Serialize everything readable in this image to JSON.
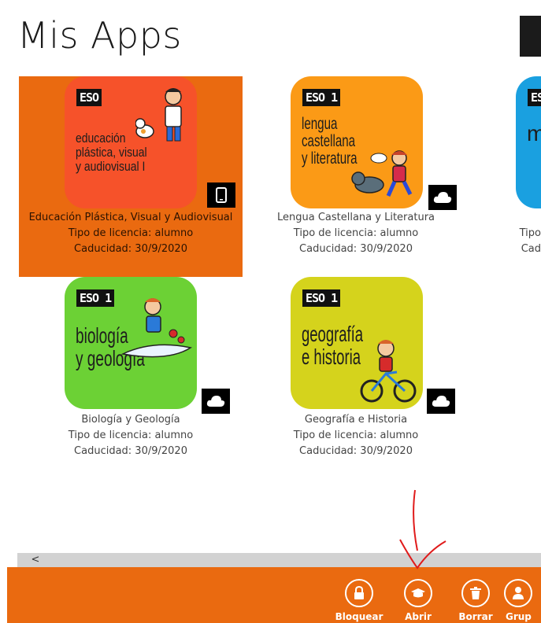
{
  "header": {
    "title": "Mis Apps"
  },
  "apps": [
    {
      "id": "plastica",
      "eso_label": "ESO",
      "cover_title": "educación\nplástica, visual\ny audiovisual I",
      "cover_color": "#f6522a",
      "badge_icon": "device-icon",
      "name": "Educación Plástica, Visual y Audiovisual",
      "license": "Tipo de licencia: alumno",
      "expiry": "Caducidad: 30/9/2020",
      "selected": true
    },
    {
      "id": "lengua",
      "eso_label": "ESO 1",
      "cover_title": "lengua castellana\ny literatura",
      "cover_color": "#fb9a16",
      "badge_icon": "cloud-icon",
      "name": "Lengua Castellana y Literatura",
      "license": "Tipo de licencia: alumno",
      "expiry": "Caducidad: 30/9/2020",
      "selected": false
    },
    {
      "id": "mates",
      "eso_label": "ES",
      "cover_title": "m",
      "cover_color": "#1aa0e0",
      "name": "",
      "license": "Tipo",
      "expiry": "Cad",
      "selected": false
    },
    {
      "id": "biologia",
      "eso_label": "ESO 1",
      "cover_title": "biología\ny geología",
      "cover_color": "#6cd135",
      "badge_icon": "cloud-icon",
      "name": "Biología y Geología",
      "license": "Tipo de licencia: alumno",
      "expiry": "Caducidad: 30/9/2020",
      "selected": false
    },
    {
      "id": "geografia",
      "eso_label": "ESO 1",
      "cover_title": "geografía\ne historia",
      "cover_color": "#d5d31c",
      "badge_icon": "cloud-icon",
      "name": "Geografía e Historia",
      "license": "Tipo de licencia: alumno",
      "expiry": "Caducidad: 30/9/2020",
      "selected": false
    }
  ],
  "scrollbar": {
    "left_arrow": "<"
  },
  "appbar": {
    "buttons": [
      {
        "label": "Bloquear",
        "icon": "lock-icon"
      },
      {
        "label": "Abrir",
        "icon": "open-book-icon"
      },
      {
        "label": "Borrar",
        "icon": "trash-icon"
      },
      {
        "label": "Grup",
        "icon": "group-icon"
      }
    ]
  },
  "colors": {
    "accent": "#ea6a10",
    "annotation": "#e01b1b"
  }
}
